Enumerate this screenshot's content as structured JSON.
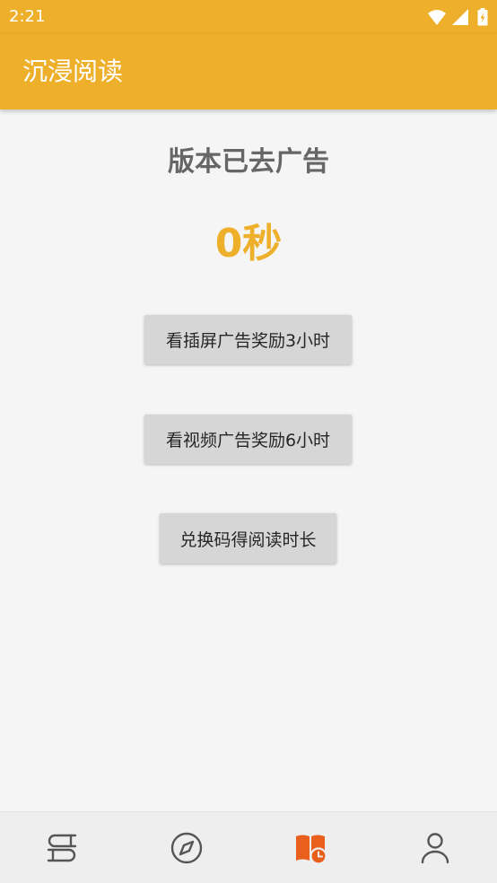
{
  "status_bar": {
    "time": "2:21",
    "icons": [
      "wifi-icon",
      "cellular-signal-icon",
      "battery-charging-icon"
    ]
  },
  "app_bar": {
    "title": "沉浸阅读"
  },
  "main": {
    "notice": "版本已去广告",
    "remaining_time": "0秒",
    "buttons": [
      {
        "label": "看插屏广告奖励3小时"
      },
      {
        "label": "看视频广告奖励6小时"
      },
      {
        "label": "兑换码得阅读时长"
      }
    ]
  },
  "bottom_nav": {
    "items": [
      {
        "icon": "bookshelf-icon",
        "active": false
      },
      {
        "icon": "compass-icon",
        "active": false
      },
      {
        "icon": "reading-time-icon",
        "active": true
      },
      {
        "icon": "person-icon",
        "active": false
      }
    ]
  },
  "colors": {
    "accent": "#EEAF2B",
    "active_tab": "#E8601C",
    "inactive_tab": "#555555",
    "button_bg": "#D6D6D6",
    "background": "#F5F5F5"
  }
}
